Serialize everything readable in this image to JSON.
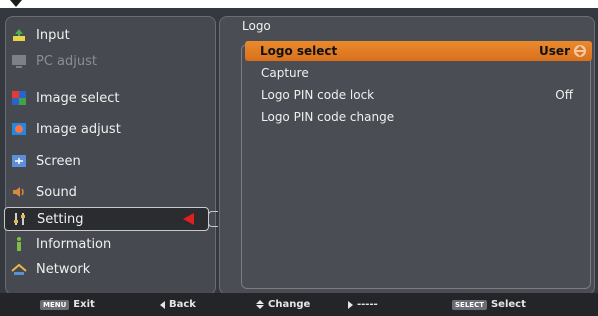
{
  "menu": {
    "items": [
      {
        "label": "Input",
        "icon": "input-icon",
        "state": "normal"
      },
      {
        "label": "PC adjust",
        "icon": "pc-adjust-icon",
        "state": "disabled"
      },
      {
        "label": "Image select",
        "icon": "image-select-icon",
        "state": "normal"
      },
      {
        "label": "Image adjust",
        "icon": "image-adjust-icon",
        "state": "normal"
      },
      {
        "label": "Screen",
        "icon": "screen-icon",
        "state": "normal"
      },
      {
        "label": "Sound",
        "icon": "sound-icon",
        "state": "normal"
      },
      {
        "label": "Setting",
        "icon": "setting-icon",
        "state": "selected"
      },
      {
        "label": "Information",
        "icon": "information-icon",
        "state": "normal"
      },
      {
        "label": "Network",
        "icon": "network-icon",
        "state": "normal"
      }
    ]
  },
  "panel": {
    "title": "Logo",
    "rows": [
      {
        "label": "Logo select",
        "value": "User"
      },
      {
        "label": "Capture",
        "value": ""
      },
      {
        "label": "Logo PIN code lock",
        "value": "Off"
      },
      {
        "label": "Logo PIN code change",
        "value": ""
      }
    ]
  },
  "footer": {
    "exit_key": "MENU",
    "exit": "Exit",
    "back": "Back",
    "change": "Change",
    "next": "-----",
    "select_key": "SELECT",
    "select": "Select"
  },
  "colors": {
    "highlight": "#e07a24",
    "selected_arrow": "#e02020",
    "background": "#34383f"
  }
}
